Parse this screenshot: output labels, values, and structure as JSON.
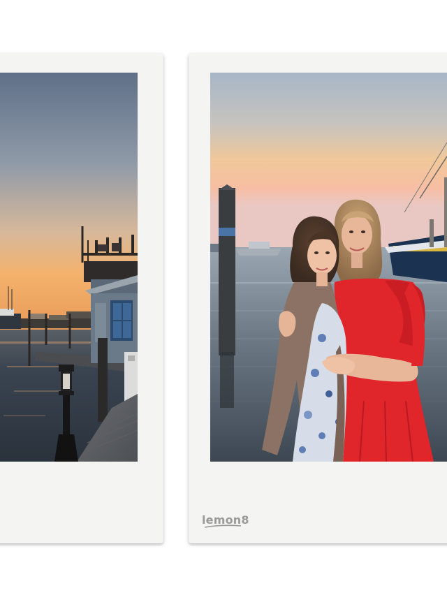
{
  "watermark": {
    "text": "lemon8",
    "color": "#9a9a9a"
  },
  "photos": [
    {
      "name": "harbor-dock-sunset",
      "sky_top": "#6f8199",
      "sky_bottom": "#f2b97a",
      "water": "#33404c"
    },
    {
      "name": "two-women-by-marina",
      "dress_color": "#e0262b",
      "cardigan_color": "#8b7264",
      "sky_top": "#a3b4c6",
      "sky_bottom": "#f6c29c"
    }
  ]
}
